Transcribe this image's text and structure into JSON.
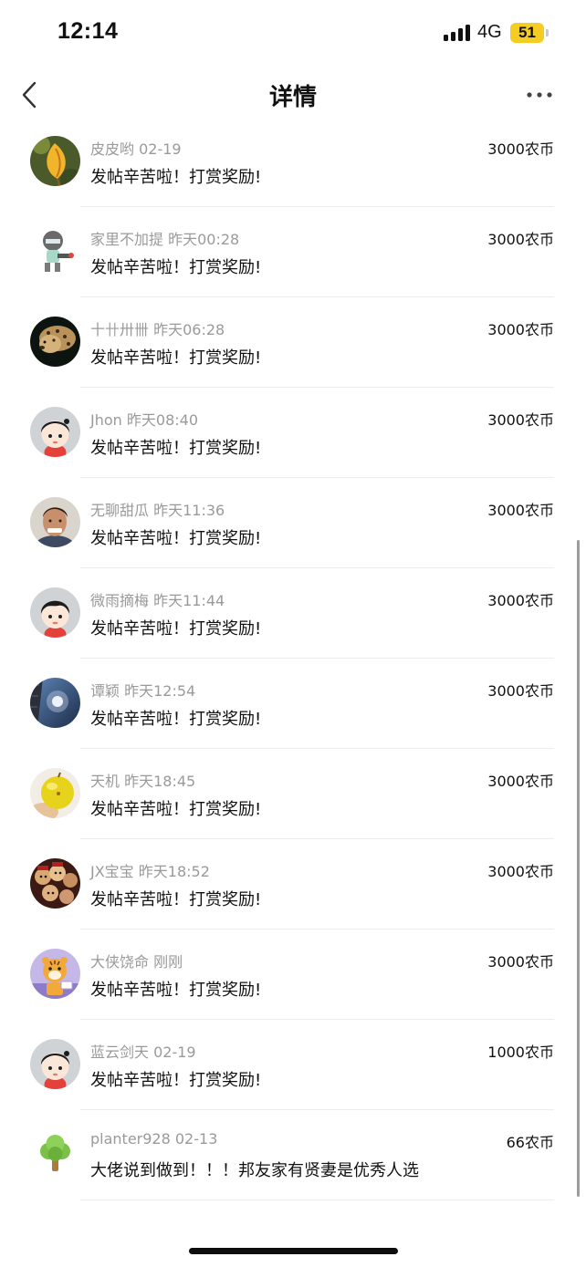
{
  "status_bar": {
    "time": "12:14",
    "network": "4G",
    "battery": "51",
    "battery_color": "#f5cc21"
  },
  "header": {
    "title": "详情",
    "back_icon": "chevron-left-icon",
    "more_icon": "more-horizontal-icon"
  },
  "colors": {
    "meta_text": "#9a9a9a",
    "divider": "#ececec"
  },
  "rewards": [
    {
      "name": "皮皮哟",
      "time": "02-19",
      "amount": "3000农币",
      "message": "发帖辛苦啦！打赏奖励!"
    },
    {
      "name": "家里不加提",
      "time": "昨天00:28",
      "amount": "3000农币",
      "message": "发帖辛苦啦！打赏奖励!"
    },
    {
      "name": "十卄卅卌",
      "time": "昨天06:28",
      "amount": "3000农币",
      "message": "发帖辛苦啦！打赏奖励!"
    },
    {
      "name": "Jhon",
      "time": "昨天08:40",
      "amount": "3000农币",
      "message": "发帖辛苦啦！打赏奖励!"
    },
    {
      "name": "无聊甜瓜",
      "time": "昨天11:36",
      "amount": "3000农币",
      "message": "发帖辛苦啦！打赏奖励!"
    },
    {
      "name": "微雨摘梅",
      "time": "昨天11:44",
      "amount": "3000农币",
      "message": "发帖辛苦啦！打赏奖励!"
    },
    {
      "name": "谭颖",
      "time": "昨天12:54",
      "amount": "3000农币",
      "message": "发帖辛苦啦！打赏奖励!"
    },
    {
      "name": "天机",
      "time": "昨天18:45",
      "amount": "3000农币",
      "message": "发帖辛苦啦！打赏奖励!"
    },
    {
      "name": "JX宝宝",
      "time": "昨天18:52",
      "amount": "3000农币",
      "message": "发帖辛苦啦！打赏奖励!"
    },
    {
      "name": "大侠饶命",
      "time": "刚刚",
      "amount": "3000农币",
      "message": "发帖辛苦啦！打赏奖励!"
    },
    {
      "name": "蓝云剑天",
      "time": "02-19",
      "amount": "1000农币",
      "message": "发帖辛苦啦！打赏奖励!"
    },
    {
      "name": "planter928",
      "time": "02-13",
      "amount": "66农币",
      "message": "大佬说到做到！！！邦友家有贤妻是优秀人选"
    }
  ]
}
